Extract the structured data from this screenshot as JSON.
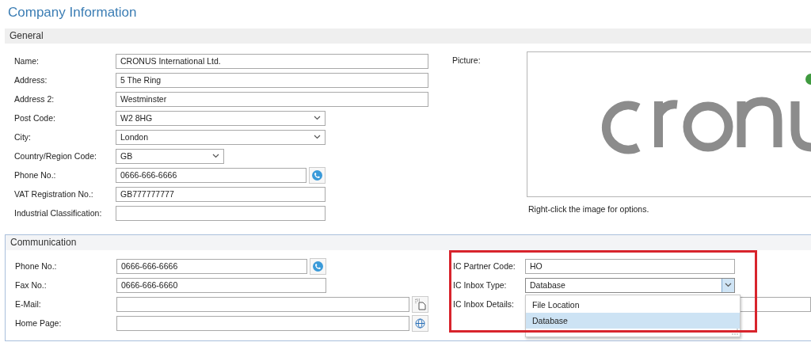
{
  "title": "Company Information",
  "general": {
    "header": "General",
    "fields": [
      {
        "label": "Name:",
        "value": "CRONUS International Ltd.",
        "kind": "long_text"
      },
      {
        "label": "Address:",
        "value": "5 The Ring",
        "kind": "long_text"
      },
      {
        "label": "Address 2:",
        "value": "Westminster",
        "kind": "long_text"
      },
      {
        "label": "Post Code:",
        "value": "W2 8HG",
        "kind": "select"
      },
      {
        "label": "City:",
        "value": "London",
        "kind": "select"
      },
      {
        "label": "Country/Region Code:",
        "value": "GB",
        "kind": "short_select"
      },
      {
        "label": "Phone No.:",
        "value": "0666-666-6666",
        "kind": "phone"
      },
      {
        "label": "VAT Registration No.:",
        "value": "GB777777777",
        "kind": "text"
      },
      {
        "label": "Industrial Classification:",
        "kind": "text"
      }
    ],
    "picture": {
      "label": "Picture:",
      "kind": "picture",
      "caption": "Right-click the image for options."
    }
  },
  "communication": {
    "header": "Communication",
    "fields": [
      {
        "label": "Phone No.:",
        "value": "0666-666-6666",
        "kind": "phone"
      },
      {
        "label": "Fax No.:",
        "value": "0666-666-6660",
        "kind": "text"
      },
      {
        "label": "E-Mail:",
        "kind": "email"
      },
      {
        "label": "Home Page:",
        "kind": "web"
      }
    ],
    "ic": {
      "highlighted": true,
      "partner_code": {
        "label": "IC Partner Code:",
        "value": "HO"
      },
      "inbox_type": {
        "label": "IC Inbox Type:",
        "value": "Database",
        "open": true,
        "options": [
          {
            "label": "File Location",
            "selected": false
          },
          {
            "label": "Database",
            "selected": true
          }
        ]
      },
      "inbox_details": {
        "label": "IC Inbox Details:"
      }
    }
  }
}
